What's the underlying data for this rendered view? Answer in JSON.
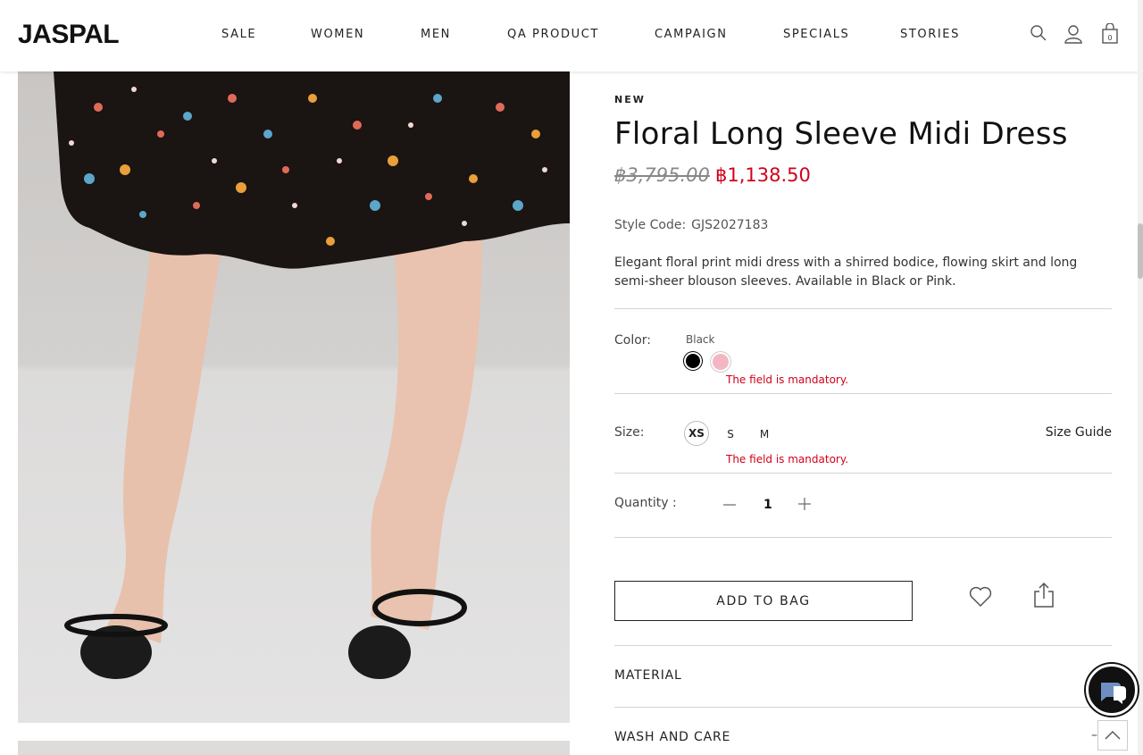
{
  "header": {
    "logo": "JASPAL",
    "nav": [
      "SALE",
      "WOMEN",
      "MEN",
      "QA PRODUCT",
      "CAMPAIGN",
      "SPECIALS",
      "STORIES"
    ],
    "cart_count": "0",
    "icons": [
      "search-icon",
      "account-icon",
      "bag-icon"
    ]
  },
  "product": {
    "badge": "NEW",
    "title": "Floral Long Sleeve Midi Dress",
    "price_original": "฿3,795.00",
    "price_sale": "฿1,138.50",
    "style_code_label": "Style Code:",
    "style_code": "GJS2027183",
    "description": "Elegant floral print midi dress with a shirred bodice, flowing skirt and long semi-sheer blouson sleeves. Available in Black or Pink.",
    "color": {
      "label": "Color:",
      "selected_name": "Black",
      "swatches": [
        {
          "name": "Black",
          "hex": "#000000"
        },
        {
          "name": "Pink",
          "hex": "#f4b6c2"
        }
      ],
      "error": "The field is mandatory."
    },
    "size": {
      "label": "Size:",
      "options": [
        "XS",
        "S",
        "M"
      ],
      "selected": "XS",
      "guide_label": "Size Guide",
      "error": "The field is mandatory."
    },
    "quantity": {
      "label": "Quantity :",
      "value": "1"
    },
    "add_to_bag": "ADD TO BAG",
    "accordions": [
      "MATERIAL",
      "WASH AND CARE"
    ]
  },
  "colors": {
    "accent_red": "#d0021b"
  }
}
